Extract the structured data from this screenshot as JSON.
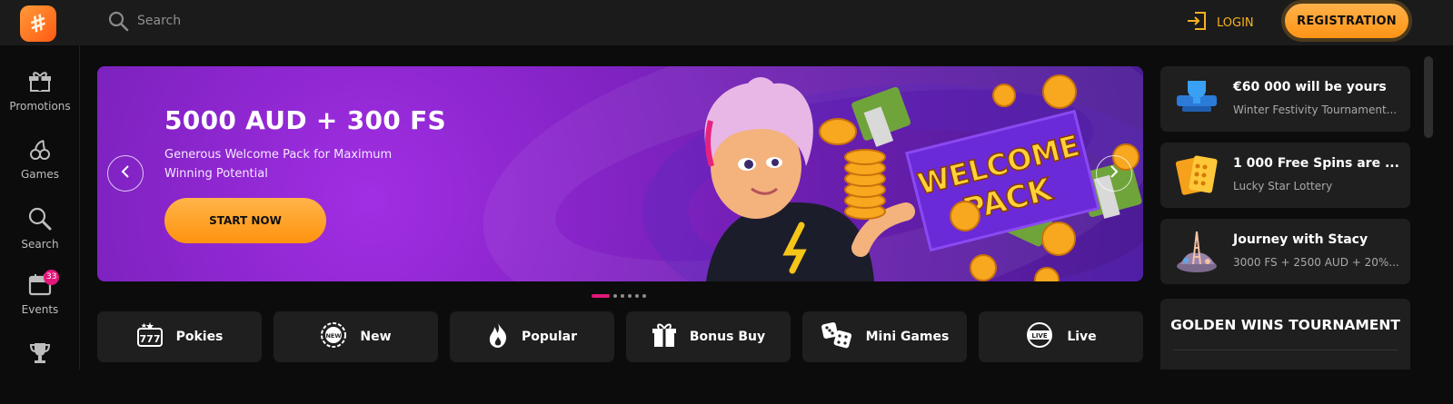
{
  "header": {
    "search_placeholder": "Search",
    "login_label": "LOGIN",
    "registration_label": "REGISTRATION"
  },
  "sidebar": {
    "items": [
      {
        "label": "Promotions",
        "icon": "gift-icon"
      },
      {
        "label": "Games",
        "icon": "cherries-icon"
      },
      {
        "label": "Search",
        "icon": "search-icon"
      },
      {
        "label": "Events",
        "icon": "calendar-icon",
        "badge": "33"
      },
      {
        "label": "",
        "icon": "trophy-icon"
      }
    ]
  },
  "hero": {
    "title": "5000 AUD + 300 FS",
    "subtitle": "Generous Welcome Pack for Maximum Winning Potential",
    "cta_label": "START NOW",
    "art_sign_line1": "WELCOME",
    "art_sign_line2": "PACK",
    "slide_count": 6,
    "active_slide": 1
  },
  "categories": [
    {
      "label": "Pokies",
      "icon": "slot-777-icon"
    },
    {
      "label": "New",
      "icon": "new-badge-icon"
    },
    {
      "label": "Popular",
      "icon": "flame-icon"
    },
    {
      "label": "Bonus Buy",
      "icon": "gift-icon"
    },
    {
      "label": "Mini Games",
      "icon": "dice-icon"
    },
    {
      "label": "Live",
      "icon": "live-icon"
    }
  ],
  "promo_cards": [
    {
      "title": "€60 000 will be yours",
      "subtitle": "Winter Festivity Tournament...",
      "icon": "tournament-trophy-icon"
    },
    {
      "title": "1 000 Free Spins are ...",
      "subtitle": "Lucky Star Lottery",
      "icon": "lottery-ticket-icon"
    },
    {
      "title": "Journey with Stacy",
      "subtitle": "3000 FS + 2500 AUD + 20%...",
      "icon": "eiffel-tower-icon"
    }
  ],
  "tournament": {
    "title": "GOLDEN WINS TOURNAMENT"
  },
  "colors": {
    "accent_orange": "#ff9a1a",
    "login_yellow": "#f6b21f",
    "badge_pink": "#e3177a",
    "hero_purple": "#8624c8"
  }
}
